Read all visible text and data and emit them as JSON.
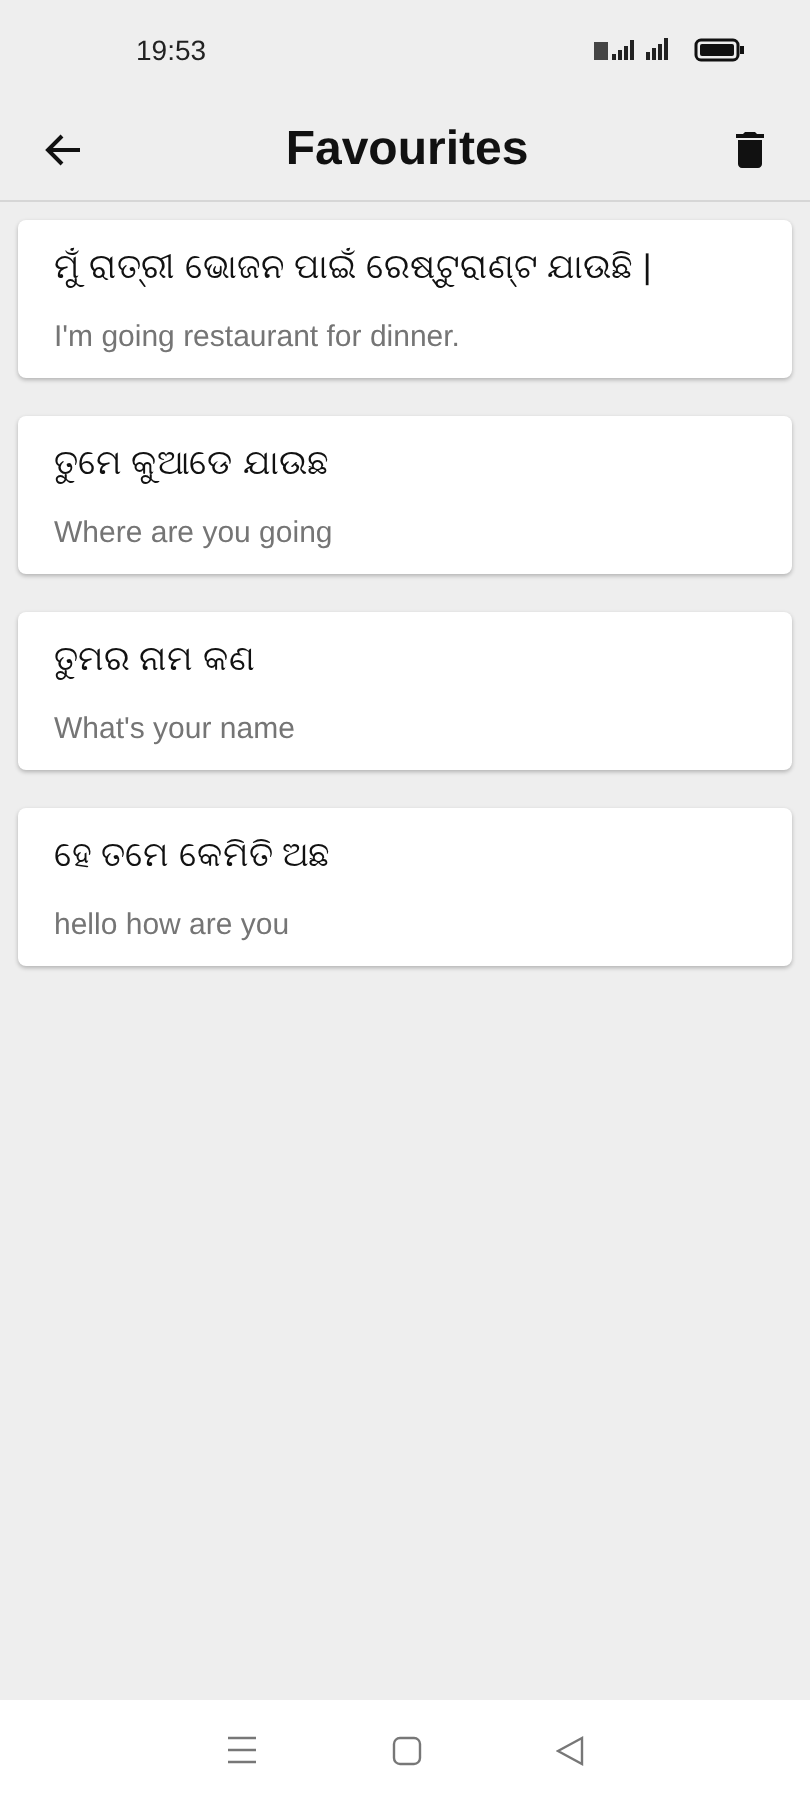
{
  "status_bar": {
    "time": "19:53"
  },
  "app_bar": {
    "title": "Favourites"
  },
  "favourites": [
    {
      "odia": "ମୁଁ ରାତ୍ରୀ ଭୋଜନ ପାଇଁ ରେଷ୍ଟୁରାଣ୍ଟ ଯାଉଛି |",
      "english": "I'm going restaurant for dinner."
    },
    {
      "odia": "ତୁମେ କୁଆଡେ ଯାଉଛ",
      "english": "Where are you going"
    },
    {
      "odia": "ତୁମର ନାମ କଣ",
      "english": "What's your name"
    },
    {
      "odia": "ହେ ତମେ କେମିତି ଅଛ",
      "english": "hello how are you"
    }
  ]
}
